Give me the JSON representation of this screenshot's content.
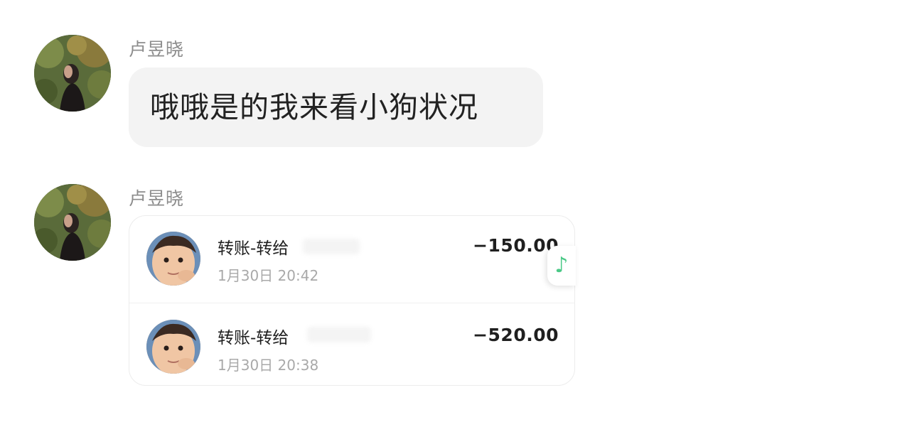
{
  "messages": [
    {
      "sender": "卢昱晓",
      "type": "text",
      "text": "哦哦是的我来看小狗状况"
    },
    {
      "sender": "卢昱晓",
      "type": "transfer_list",
      "transfers": [
        {
          "title": "转账-转给",
          "time": "1月30日 20:42",
          "amount": "−150.00"
        },
        {
          "title": "转账-转给",
          "time": "1月30日 20:38",
          "amount": "−520.00"
        }
      ]
    }
  ],
  "icons": {
    "music": "music-note-icon"
  },
  "colors": {
    "bubble_bg": "#f3f3f3",
    "sender_name": "#8c8c8c",
    "music_note": "#4bc987"
  }
}
